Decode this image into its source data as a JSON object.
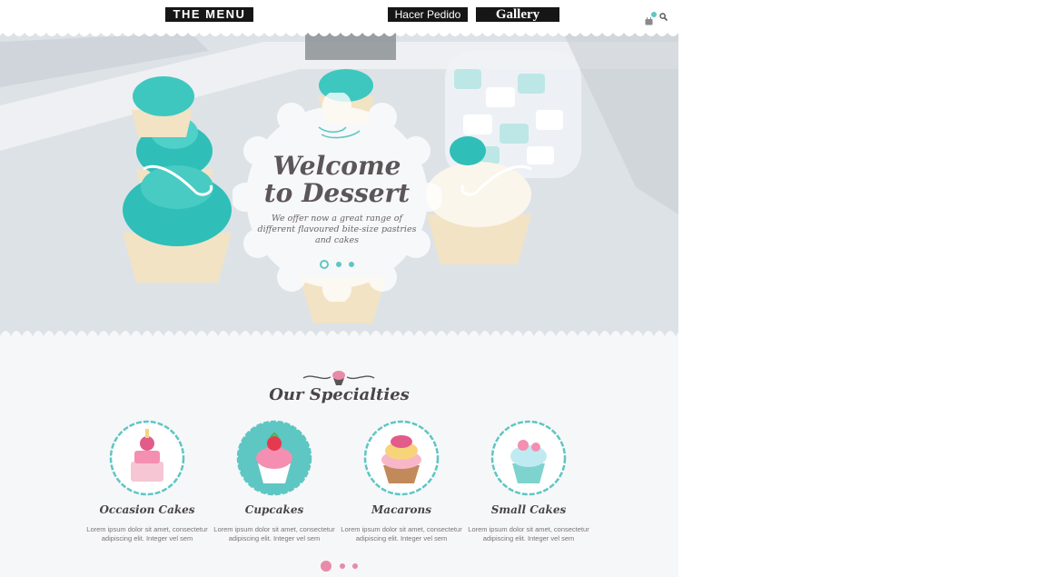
{
  "nav": {
    "menu_label": "THE MENU",
    "order_label": "Hacer Pedido",
    "gallery_label": "Gallery",
    "icons": [
      "cart-icon",
      "search-icon"
    ]
  },
  "hero": {
    "title_line1": "Welcome",
    "title_line2": "to Dessert",
    "subtitle": "We offer now a great range of different flavoured bite-size pastries and cakes",
    "slides": 3,
    "active_slide": 1
  },
  "specialties": {
    "title": "Our Specialties",
    "items": [
      {
        "title": "Occasion Cakes",
        "desc": "Lorem ipsum dolor sit amet, consectetur adipiscing elit. Integer vel sem",
        "icon": "occasion-cake-icon"
      },
      {
        "title": "Cupcakes",
        "desc": "Lorem ipsum dolor sit amet, consectetur adipiscing elit. Integer vel sem",
        "icon": "cupcake-icon"
      },
      {
        "title": "Macarons",
        "desc": "Lorem ipsum dolor sit amet, consectetur adipiscing elit. Integer vel sem",
        "icon": "macaron-icon"
      },
      {
        "title": "Small Cakes",
        "desc": "Lorem ipsum dolor sit amet, consectetur adipiscing elit. Integer vel sem",
        "icon": "small-cake-icon"
      }
    ],
    "pager_pages": 3
  },
  "colors": {
    "accent": "#5ec6c3",
    "pink": "#e88aa8",
    "text": "#4a4446"
  }
}
